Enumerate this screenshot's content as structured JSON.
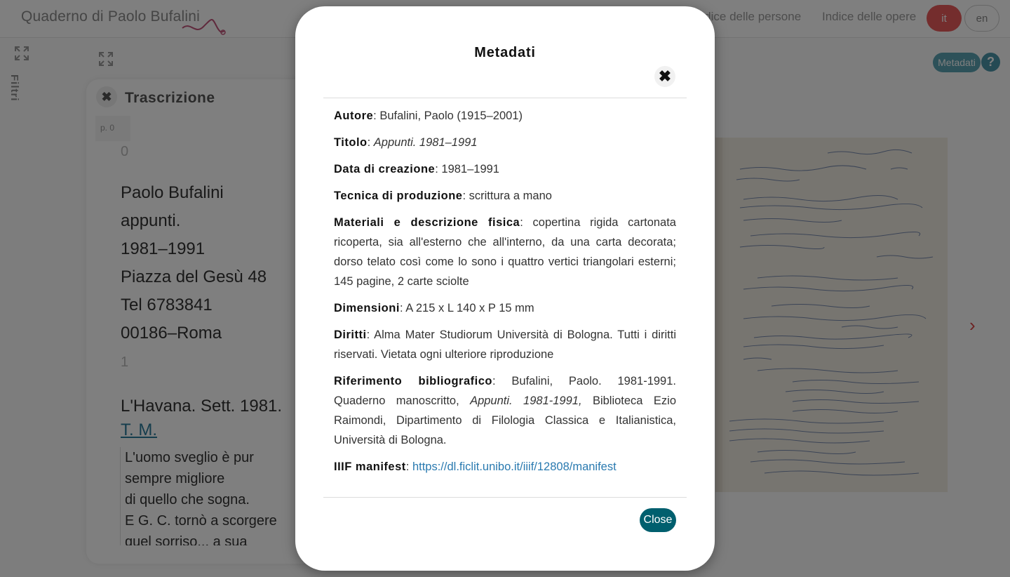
{
  "app": {
    "logo_text": "Quaderno di Paolo Bufalini",
    "nav": [
      "Indice delle persone",
      "Indice delle opere"
    ],
    "lang": {
      "it": "it",
      "en": "en"
    },
    "sidebar_label": "Filtri",
    "help": "?"
  },
  "panel": {
    "close_glyph": "✖",
    "title": "Trascrizione",
    "page_tag": "p. 0",
    "num0": "0",
    "lines": [
      "Paolo Bufalini",
      "appunti.",
      "1981–1991",
      "Piazza del Gesù 48",
      "Tel 6783841",
      "00186–Roma"
    ],
    "num1": "1",
    "line_havana": "L'Havana. Sett. 1981.",
    "link_tm": "T. M.",
    "box_lines": [
      "L'uomo sveglio è pur",
      "sempre migliore",
      "di quello che sogna.",
      "E G. C. tornò a scorgere",
      "quel sorriso... a sua"
    ]
  },
  "viewer": {
    "metadata_pill": "Metadati",
    "next_arrow": "›"
  },
  "modal": {
    "title": "Metadati",
    "close_x": "✖",
    "close_button": "Close",
    "fields": {
      "autore": {
        "label": "Autore",
        "value": ": Bufalini, Paolo (1915–2001)"
      },
      "titolo": {
        "label": "Titolo",
        "sep": ": ",
        "value": "Appunti. 1981–1991"
      },
      "data": {
        "label": "Data di creazione",
        "value": ": 1981–1991"
      },
      "tecnica": {
        "label": "Tecnica di produzione",
        "value": ": scrittura a mano"
      },
      "materiali": {
        "label": "Materiali e descrizione fisica",
        "value": ": copertina rigida cartonata ricoperta, sia all'esterno che all'interno, da una carta decorata; dorso telato così come lo sono i quattro vertici triangolari esterni; 145 pagine, 2 carte sciolte"
      },
      "dimensioni": {
        "label": "Dimensioni",
        "value": ": A 215 x L 140 x P 15 mm"
      },
      "diritti": {
        "label": "Diritti",
        "value": ": Alma Mater Studiorum Università di Bologna. Tutti i diritti riservati. Vietata ogni ulteriore riproduzione"
      },
      "riferimento": {
        "label": "Riferimento bibliografico",
        "value_a": ": Bufalini, Paolo. 1981-1991. Quaderno manoscritto, ",
        "value_ital": "Appunti. 1981-1991,",
        "value_b": " Biblioteca Ezio Raimondi, Dipartimento di Filologia Classica e Italianistica, Università di Bologna."
      },
      "iiif": {
        "label": "IIIF manifest",
        "sep": ": ",
        "link": "https://dl.ficlit.unibo.it/iiif/12808/manifest"
      }
    }
  }
}
